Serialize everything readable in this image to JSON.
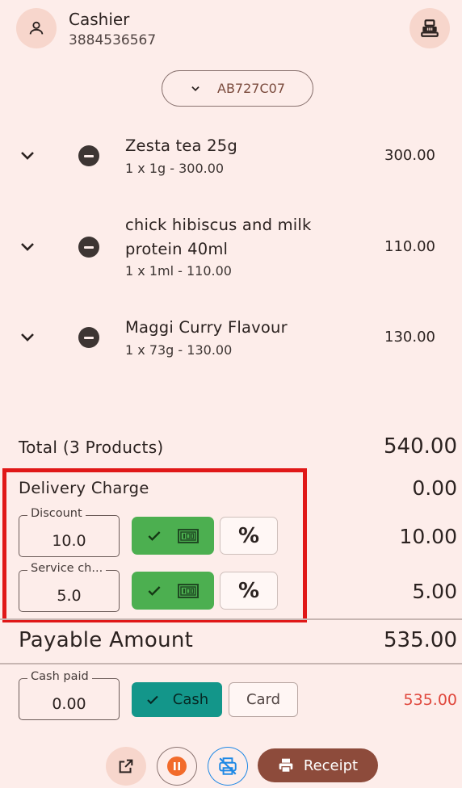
{
  "header": {
    "title": "Cashier",
    "phone": "3884536567",
    "user_icon": "person-icon",
    "register_icon": "cash-register-icon"
  },
  "order": {
    "code": "AB727C07"
  },
  "items": [
    {
      "name": "Zesta tea 25g",
      "detail": "1 x 1g - 300.00",
      "price": "300.00"
    },
    {
      "name": "chick hibiscus and milk protein 40ml",
      "detail": "1 x 1ml - 110.00",
      "price": "110.00"
    },
    {
      "name": "Maggi Curry Flavour",
      "detail": "1 x 73g - 130.00",
      "price": "130.00"
    }
  ],
  "totals": {
    "total_label": "Total (3 Products)",
    "total_value": "540.00",
    "delivery_label": "Delivery Charge",
    "delivery_value": "0.00"
  },
  "discount": {
    "label": "Discount",
    "value": "10.0",
    "amount": "10.00",
    "percent_label": "%"
  },
  "service": {
    "label": "Service ch...",
    "value": "5.0",
    "amount": "5.00",
    "percent_label": "%"
  },
  "payable": {
    "label": "Payable Amount",
    "value": "535.00"
  },
  "payment": {
    "cash_paid_label": "Cash paid",
    "cash_paid_value": "0.00",
    "cash_label": "Cash",
    "card_label": "Card",
    "amount": "535.00"
  },
  "bottom": {
    "receipt_label": "Receipt"
  },
  "colors": {
    "background": "#fdedea",
    "accent_green": "#4caf50",
    "teal": "#13968a",
    "receipt": "#8d4b3b",
    "highlight": "#e01818",
    "cash_amount": "#e0473c",
    "pause": "#f26b2b",
    "printer_off": "#1e88e5"
  }
}
